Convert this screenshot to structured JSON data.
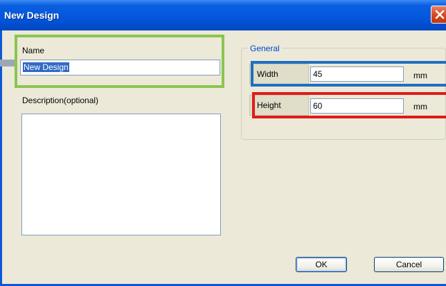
{
  "window": {
    "title": "New Design",
    "close_icon": "close-icon"
  },
  "name_section": {
    "label": "Name",
    "value": "New Design"
  },
  "description": {
    "label": "Description(optional)",
    "value": ""
  },
  "general": {
    "title": "General",
    "width": {
      "label": "Width",
      "value": "45",
      "unit": "mm"
    },
    "height": {
      "label": "Height",
      "value": "60",
      "unit": "mm"
    }
  },
  "buttons": {
    "ok": "OK",
    "cancel": "Cancel"
  },
  "highlight_colors": {
    "name": "#8bc550",
    "width": "#1f6fc2",
    "height": "#e11a1a"
  }
}
